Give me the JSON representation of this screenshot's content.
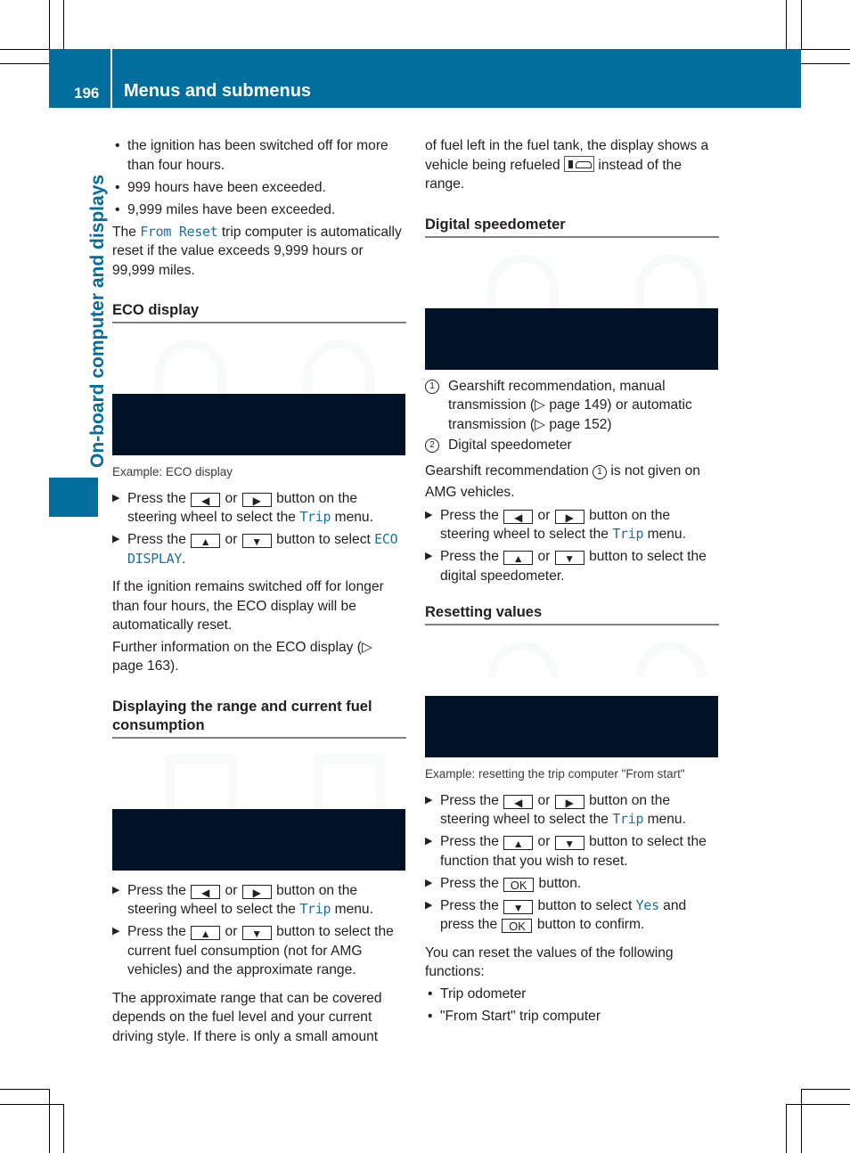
{
  "header": {
    "page_number": "196",
    "title": "Menus and submenus"
  },
  "side_tab": {
    "label": "On-board computer and displays"
  },
  "left_column": {
    "intro_bullets": [
      "the ignition has been switched off for more than four hours.",
      "999 hours have been exceeded.",
      "9,999 miles have been exceeded."
    ],
    "reset_para": {
      "pre": "The ",
      "highlight": "From Reset",
      "post": " trip computer is automatically reset if the value exceeds 9,999 hours or 99,999 miles."
    },
    "eco_section": {
      "heading": "ECO display",
      "caption": "Example: ECO display",
      "step1": {
        "pre": "Press the ",
        "or": " or ",
        "mid": " button on the steering wheel to select the ",
        "highlight": "Trip",
        "post": " menu."
      },
      "step2": {
        "pre": "Press the ",
        "or": " or ",
        "mid": " button to select ",
        "highlight": "ECO DISPLAY",
        "post": "."
      },
      "para1": "If the ignition remains switched off for longer than four hours, the ECO display will be automatically reset.",
      "para2": "Further information on the ECO display (▷ page 163)."
    },
    "range_section": {
      "heading": "Displaying the range and current fuel consumption",
      "step1": {
        "pre": "Press the ",
        "or": " or ",
        "mid": " button on the steering wheel to select the ",
        "highlight": "Trip",
        "post": " menu."
      },
      "step2": {
        "pre": "Press the ",
        "or": " or ",
        "post": " button to select the current fuel consumption (not for AMG vehicles) and the approximate range."
      },
      "para": "The approximate range that can be covered depends on the fuel level and your current driving style. If there is only a small amount"
    }
  },
  "right_column": {
    "continued_para": {
      "pre": "of fuel left in the fuel tank, the display shows a vehicle being refueled ",
      "post": " instead of the range."
    },
    "refuel_icon": "fuel-pump-car-icon",
    "speedo_section": {
      "heading": "Digital speedometer",
      "legend": [
        {
          "num": "1",
          "text": "Gearshift recommendation, manual transmission (▷ page 149) or automatic transmission (▷ page 152)"
        },
        {
          "num": "2",
          "text": "Digital speedometer"
        }
      ],
      "note": {
        "pre": "Gearshift recommendation ",
        "num": "1",
        "post": " is not given on AMG vehicles."
      },
      "step1": {
        "pre": "Press the ",
        "or": " or ",
        "mid": " button on the steering wheel to select the ",
        "highlight": "Trip",
        "post": " menu."
      },
      "step2": {
        "pre": "Press the ",
        "or": " or ",
        "post": " button to select the digital speedometer."
      }
    },
    "reset_section": {
      "heading": "Resetting values",
      "caption": "Example: resetting the trip computer \"From start\"",
      "step1": {
        "pre": "Press the ",
        "or": " or ",
        "mid": " button on the steering wheel to select the ",
        "highlight": "Trip",
        "post": " menu."
      },
      "step2": {
        "pre": "Press the ",
        "or": " or ",
        "post": " button to select the function that you wish to reset."
      },
      "step3": {
        "pre": "Press the ",
        "post": " button."
      },
      "step4": {
        "pre": "Press the ",
        "mid": " button to select ",
        "highlight": "Yes",
        "mid2": " and press the ",
        "post": " button to confirm."
      },
      "para": "You can reset the values of the following functions:",
      "bullets": [
        "Trip odometer",
        "\"From Start\" trip computer"
      ]
    }
  },
  "keys": {
    "left": "◀",
    "right": "▶",
    "up": "▲",
    "down": "▼",
    "ok": "OK"
  },
  "step_marker": "▶"
}
